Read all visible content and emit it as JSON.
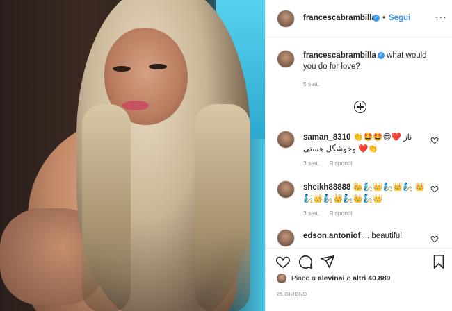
{
  "header": {
    "username": "francescabrambilla",
    "verified_mark": "✓",
    "separator": "•",
    "follow_label": "Segui",
    "more_label": "···"
  },
  "caption": {
    "username": "francescabrambilla",
    "text": "what would you do for love?",
    "time": "5 sett."
  },
  "load_more_icon": "plus-circle-icon",
  "comments": [
    {
      "username": "saman_8310",
      "text": "👏🤩🤩😍❤️ ناز وخوشگل هستی ❤️👏",
      "time": "3 sett.",
      "reply_label": "Rispondi"
    },
    {
      "username": "sheikh88888",
      "text": "👑🧞👑🧞👑🧞 👑🧞👑🧞👑🧞👑🧞👑",
      "time": "3 sett.",
      "reply_label": "Rispondi"
    },
    {
      "username": "edson.antoniof",
      "text": "... beautiful",
      "time": "",
      "reply_label": ""
    }
  ],
  "actions": {
    "like_icon": "heart-icon",
    "comment_icon": "comment-icon",
    "share_icon": "paper-plane-icon",
    "save_icon": "bookmark-icon"
  },
  "likes": {
    "prefix": "Piace a",
    "first_user": "alevinai",
    "joiner": "e",
    "others": "altri 40.889"
  },
  "post_date": "25 GIUGNO",
  "colors": {
    "link_blue": "#3897f0",
    "text": "#262626",
    "muted": "#8e8e8e"
  }
}
